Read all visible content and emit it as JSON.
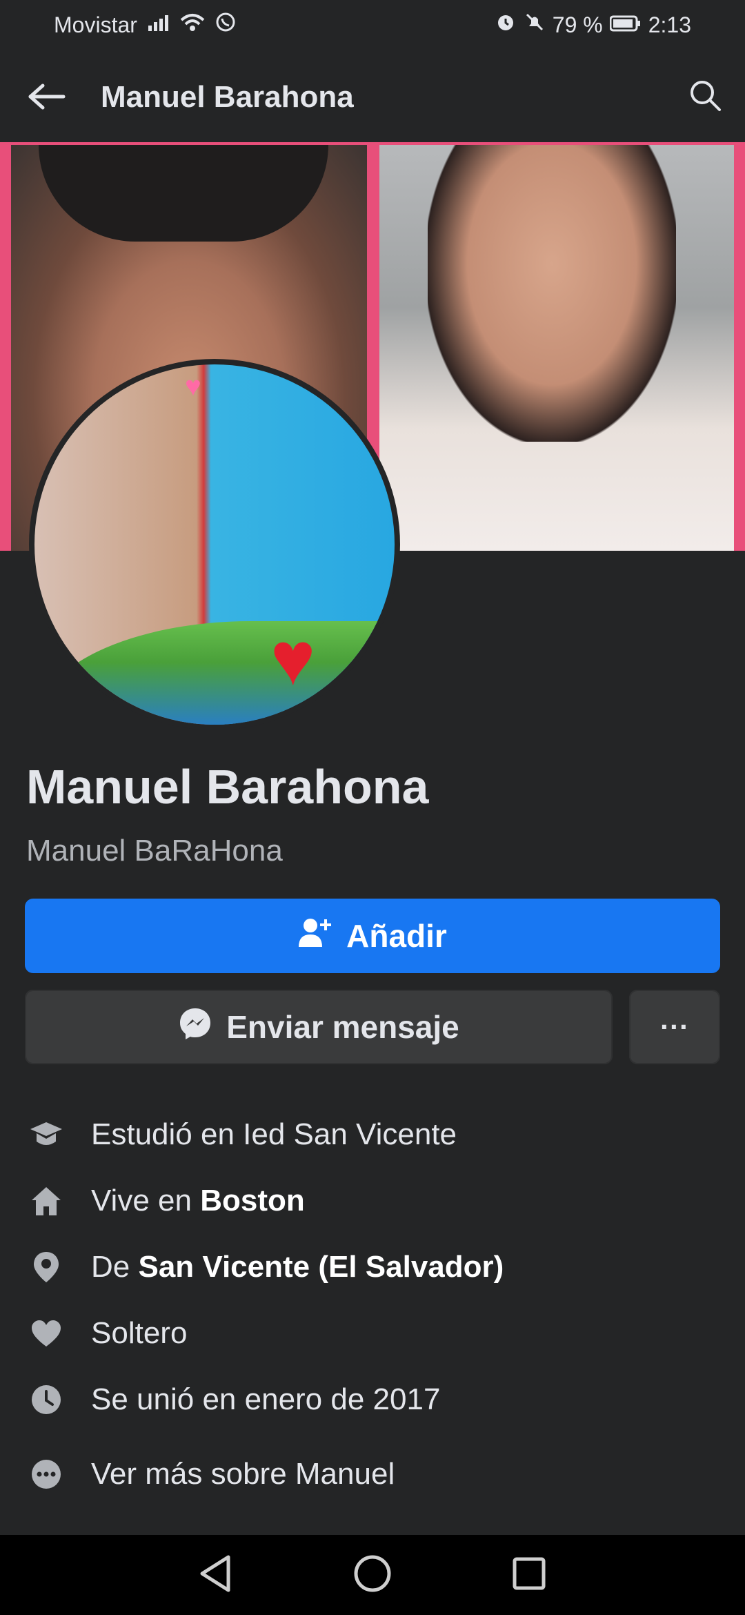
{
  "status": {
    "carrier": "Movistar",
    "battery_percent": "79 %",
    "time": "2:13"
  },
  "header": {
    "title": "Manuel Barahona"
  },
  "profile": {
    "name": "Manuel Barahona",
    "alternate_name": "Manuel BaRaHona"
  },
  "actions": {
    "add_label": "Añadir",
    "message_label": "Enviar mensaje",
    "more_label": "···"
  },
  "info": {
    "education": "Estudió en Ied San Vicente",
    "lives_prefix": "Vive en",
    "lives_city": "Boston",
    "from_prefix": "De",
    "from_place": "San Vicente (El Salvador)",
    "relationship": "Soltero",
    "joined": "Se unió en enero de 2017",
    "see_more": "Ver más sobre Manuel"
  },
  "icons": {
    "back": "arrow-left-icon",
    "search": "search-icon",
    "add_friend": "add-friend-icon",
    "messenger": "messenger-icon",
    "education": "graduation-cap-icon",
    "home": "home-icon",
    "location": "location-pin-icon",
    "heart": "heart-icon",
    "clock": "clock-icon",
    "more": "more-dots-icon"
  },
  "colors": {
    "background": "#242526",
    "primary_button": "#1877f2",
    "secondary_button": "#3a3b3c",
    "text_primary": "#e4e6eb",
    "text_secondary": "#b0b3b8"
  }
}
